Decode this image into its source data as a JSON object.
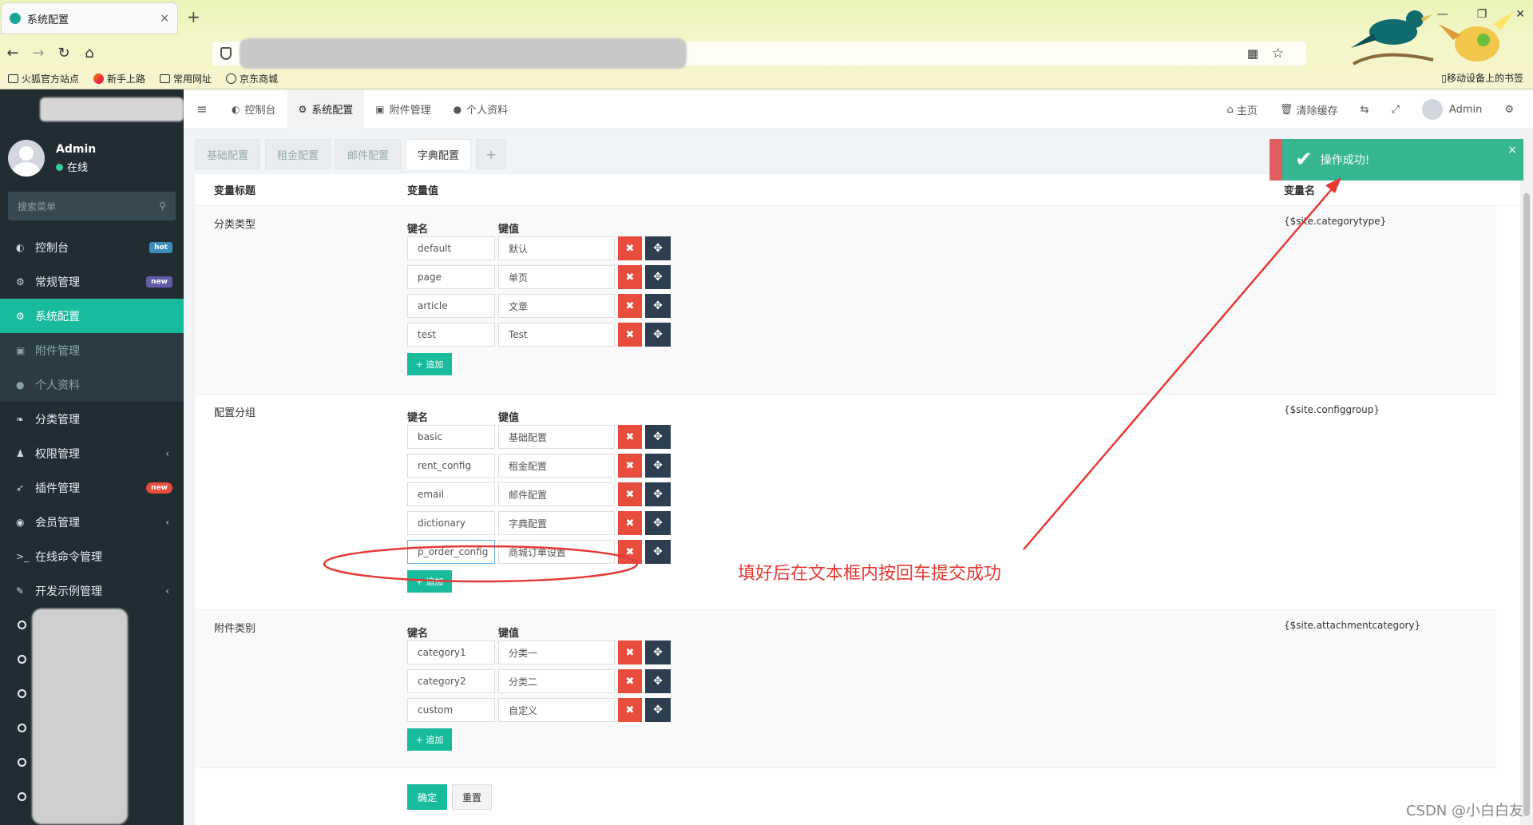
{
  "browser": {
    "tab_title": "系统配置",
    "tab_close": "×",
    "new_tab": "+",
    "bookmarks": [
      "火狐官方站点",
      "新手上路",
      "常用网址",
      "京东商城"
    ],
    "mobile_bookmarks": "移动设备上的书签"
  },
  "sidebar": {
    "user_name": "Admin",
    "user_status": "在线",
    "search_placeholder": "搜索菜单",
    "menu": [
      {
        "label": "控制台",
        "badge": "hot"
      },
      {
        "label": "常规管理",
        "badge": "new"
      },
      {
        "label": "系统配置",
        "active": true
      },
      {
        "label": "附件管理"
      },
      {
        "label": "个人资料"
      },
      {
        "label": "分类管理"
      },
      {
        "label": "权限管理"
      },
      {
        "label": "插件管理",
        "badge": "new"
      },
      {
        "label": "会员管理"
      },
      {
        "label": "在线命令管理"
      },
      {
        "label": "开发示例管理"
      }
    ]
  },
  "topnav": {
    "tabs": [
      "控制台",
      "系统配置",
      "附件管理",
      "个人资料"
    ],
    "right": {
      "home": "主页",
      "clear_cache": "清除缓存",
      "user": "Admin"
    }
  },
  "config_tabs": [
    "基础配置",
    "租金配置",
    "邮件配置",
    "字典配置",
    "+"
  ],
  "table": {
    "col_title": "变量标题",
    "col_value": "变量值",
    "col_name": "变量名",
    "key_header": "键名",
    "value_header": "键值",
    "add_label": "+ 追加",
    "groups": [
      {
        "title": "分类类型",
        "var": "{$site.categorytype}",
        "rows": [
          [
            "default",
            "默认"
          ],
          [
            "page",
            "单页"
          ],
          [
            "article",
            "文章"
          ],
          [
            "test",
            "Test"
          ]
        ]
      },
      {
        "title": "配置分组",
        "var": "{$site.configgroup}",
        "rows": [
          [
            "basic",
            "基础配置"
          ],
          [
            "rent_config",
            "租金配置"
          ],
          [
            "email",
            "邮件配置"
          ],
          [
            "dictionary",
            "字典配置"
          ],
          [
            "p_order_config",
            "商城订单设置"
          ]
        ]
      },
      {
        "title": "附件类别",
        "var": "{$site.attachmentcategory}",
        "rows": [
          [
            "category1",
            "分类一"
          ],
          [
            "category2",
            "分类二"
          ],
          [
            "custom",
            "自定义"
          ]
        ]
      }
    ],
    "submit": "确定",
    "reset": "重置"
  },
  "toast": {
    "text": "操作成功!",
    "close": "×"
  },
  "annotation": {
    "text": "填好后在文本框内按回车提交成功",
    "color": "#e53935"
  },
  "watermark": "CSDN @小白白友"
}
